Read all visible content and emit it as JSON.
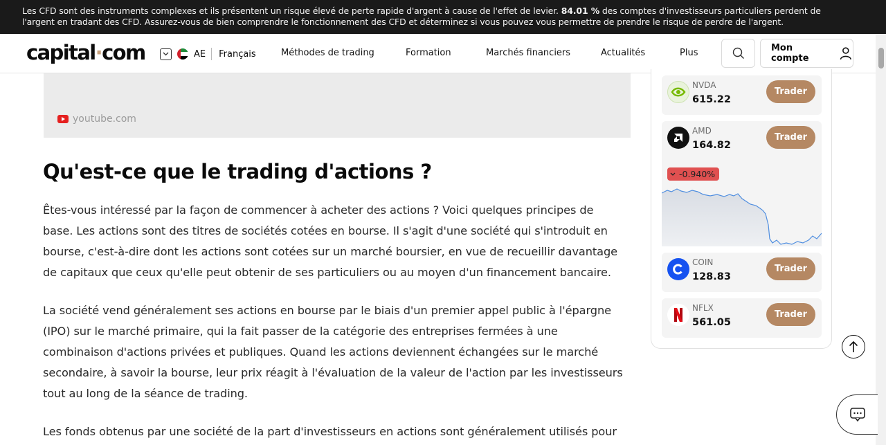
{
  "banner": {
    "text_before": "Les CFD sont des instruments complexes et ils présentent un risque élevé de perte rapide d'argent à cause de l'effet de levier. ",
    "pct": "84.01 %",
    "text_after": " des comptes d'investisseurs particuliers perdent de l'argent en tradant des CFD. Assurez-vous de bien comprendre le fonctionnement des CFD et déterminez si vous pouvez vous permettre de prendre le risque de perdre de l'argent."
  },
  "header": {
    "logo_left": "capital",
    "logo_dot": "·",
    "logo_right": "com",
    "region": "AE",
    "language": "Français",
    "nav": [
      "Méthodes de trading",
      "Formation",
      "Marchés financiers",
      "Actualités",
      "Plus"
    ],
    "account_label": "Mon compte"
  },
  "video": {
    "source": "youtube.com"
  },
  "article": {
    "title": "Qu'est-ce que le trading d'actions ?",
    "paragraphs": [
      [
        "Êtes-vous intéressé par la façon de commencer à acheter des actions ? Voici quelques principes de",
        "base. Les actions sont des titres de sociétés cotées en bourse. Il s'agit d'une société qui s'introduit en",
        "bourse, c'est-à-dire dont les actions sont cotées sur un marché boursier, en vue de recueillir davantage",
        "de capitaux que ceux qu'elle peut obtenir de ses particuliers ou au moyen d'un financement bancaire."
      ],
      [
        "La société vend généralement ses actions en bourse par le biais d'un premier appel public à l'épargne",
        "(IPO) sur le marché primaire, qui la fait passer de la catégorie des entreprises fermées à une",
        "combinaison d'actions privées et publiques. Quand les actions deviennent échangées sur le marché",
        "secondaire, à savoir la bourse, leur prix réagit à l'évaluation de la valeur de l'action par les investisseurs",
        "tout au long de la séance de trading."
      ],
      [
        "Les fonds obtenus par une société de la part d'investisseurs en actions sont généralement utilisés pour"
      ]
    ]
  },
  "tickers": [
    {
      "symbol": "NVDA",
      "price": "615.22",
      "trade": "Trader",
      "icon": "nvidia-logo",
      "color": "#76b900"
    },
    {
      "symbol": "AMD",
      "price": "164.82",
      "trade": "Trader",
      "icon": "amd-logo",
      "color": "#111111",
      "change": "-0.940%",
      "change_color": "#e05050"
    },
    {
      "symbol": "COIN",
      "price": "128.83",
      "trade": "Trader",
      "icon": "coinbase-logo",
      "color": "#1652f0"
    },
    {
      "symbol": "NFLX",
      "price": "561.05",
      "trade": "Trader",
      "icon": "netflix-logo",
      "color": "#e50914"
    }
  ]
}
